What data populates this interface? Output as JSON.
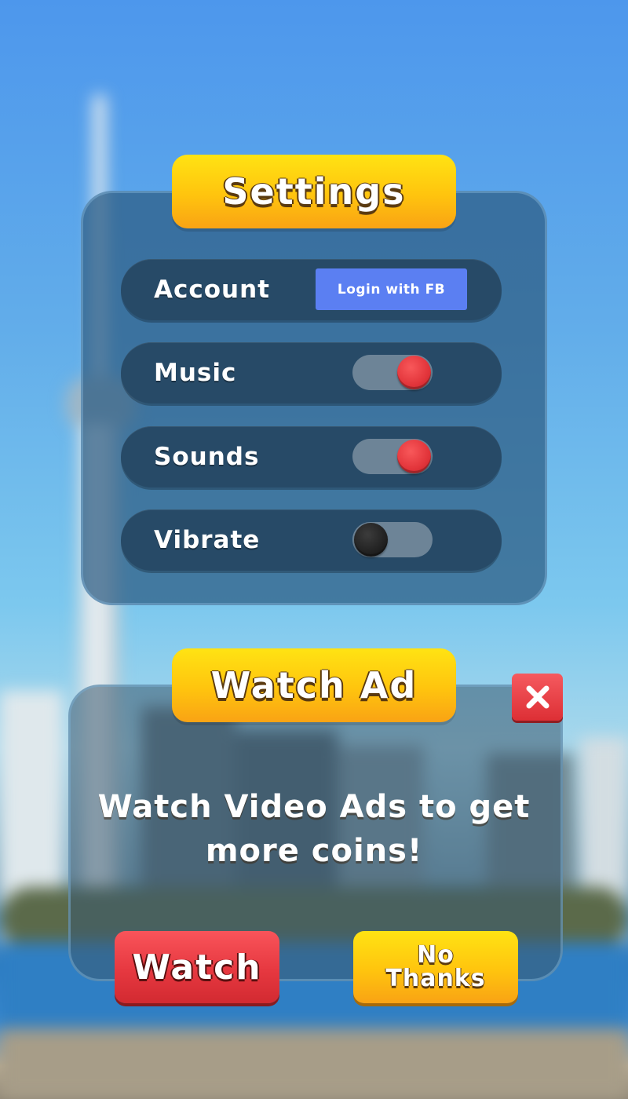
{
  "settings": {
    "title": "Settings",
    "rows": [
      {
        "label": "Account",
        "button_label": "Login with FB"
      },
      {
        "label": "Music",
        "toggle_state": "on"
      },
      {
        "label": "Sounds",
        "toggle_state": "on"
      },
      {
        "label": "Vibrate",
        "toggle_state": "off"
      }
    ]
  },
  "watch_ad": {
    "title": "Watch Ad",
    "close_icon": "close-x-icon",
    "message": "Watch Video Ads to get more coins!",
    "watch_label": "Watch",
    "no_thanks_line1": "No",
    "no_thanks_line2": "Thanks"
  },
  "colors": {
    "title_badge": "#ffc40e",
    "row_bg": "#274a67",
    "toggle_on_knob": "#e2343a",
    "toggle_off_knob": "#1d1d1d",
    "fb_button": "#5b7ff2",
    "watch_button": "#e63840",
    "close_button": "#dd2f35"
  }
}
